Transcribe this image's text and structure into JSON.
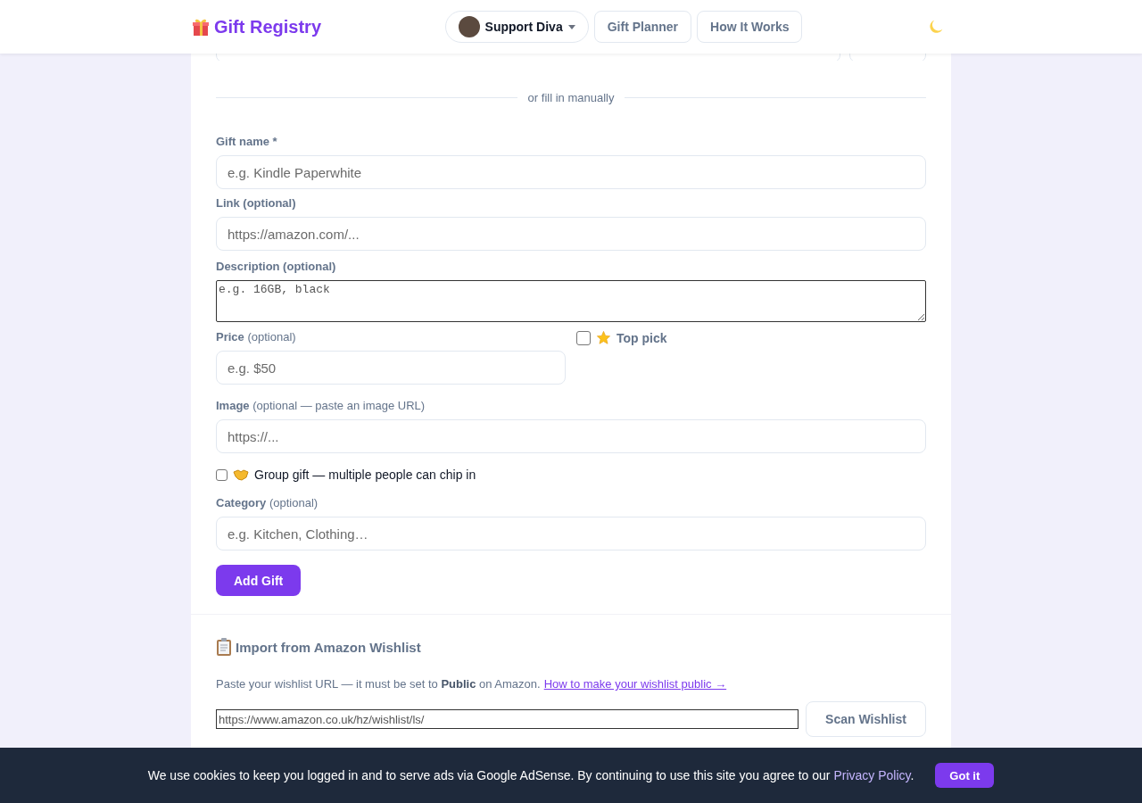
{
  "header": {
    "brand": "Gift Registry",
    "nav": [
      {
        "kind": "menu",
        "label": "Support Diva"
      },
      {
        "kind": "link",
        "label": "Gift Planner"
      },
      {
        "kind": "link",
        "label": "How It Works"
      }
    ]
  },
  "divider_text": "or fill in manually",
  "form": {
    "fields": [
      {
        "kind": "input",
        "label": "Gift name *",
        "placeholder": "e.g. Kindle Paperwhite"
      },
      {
        "kind": "input",
        "label": "Link (optional)",
        "placeholder": "https://amazon.com/..."
      },
      {
        "kind": "textarea",
        "label": "Description (optional)",
        "placeholder": "e.g. 16GB, black"
      },
      {
        "kind": "price",
        "label": "Price",
        "note": "(optional)",
        "placeholder": "e.g. $50",
        "toggle": {
          "label": "Top pick",
          "checked": false
        }
      },
      {
        "kind": "input",
        "label": "Image",
        "note": "(optional — paste an image URL)",
        "placeholder": "https://..."
      },
      {
        "kind": "checkbox",
        "label": "Group gift — multiple people can chip in",
        "checked": false
      },
      {
        "kind": "input",
        "label": "Category",
        "note": "(optional)",
        "placeholder": "e.g. Kitchen, Clothing…"
      }
    ],
    "submit": "Add Gift"
  },
  "import": {
    "title": "Import from Amazon Wishlist",
    "text": "Paste your wishlist URL — it must be set to **Public** on Amazon.",
    "link": "How to make your wishlist public →",
    "value": "https://www.amazon.co.uk/hz/wishlist/ls/",
    "button": "Scan Wishlist"
  },
  "cookie": {
    "text": "We use cookies to keep you logged in and to serve ads via Google AdSense. By continuing to use this site you agree to our",
    "link": "Privacy Policy",
    "end": ".",
    "button": "Got it"
  }
}
